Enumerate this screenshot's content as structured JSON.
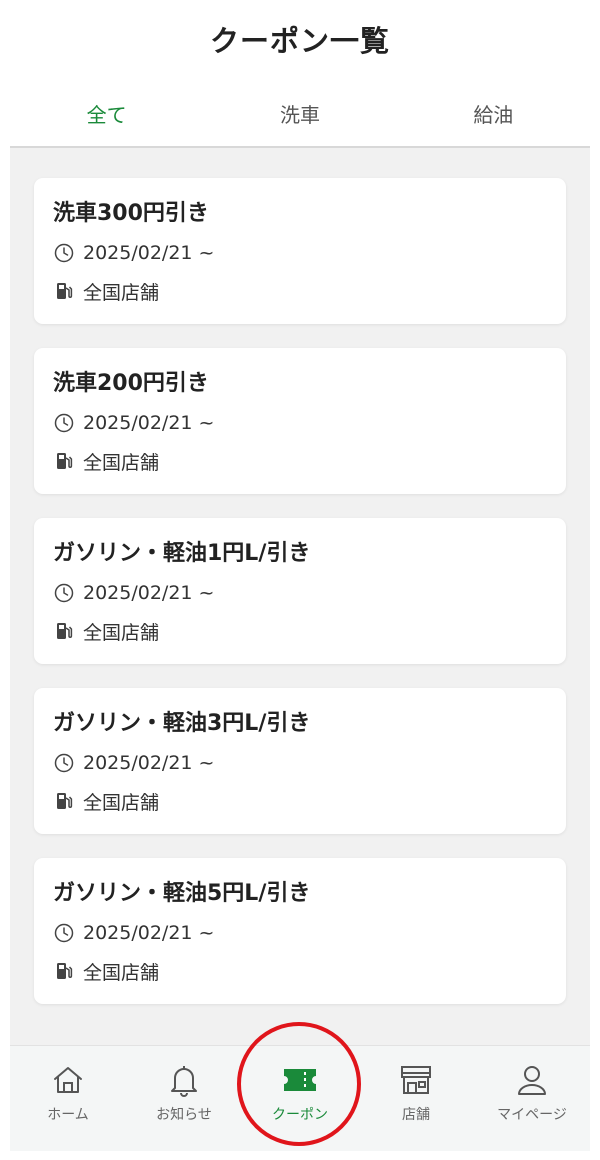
{
  "header": {
    "title": "クーポン一覧"
  },
  "tabs": [
    {
      "label": "全て",
      "active": true
    },
    {
      "label": "洗車",
      "active": false
    },
    {
      "label": "給油",
      "active": false
    }
  ],
  "coupons": [
    {
      "title": "洗車300円引き",
      "date": "2025/02/21 ~",
      "store": "全国店舗"
    },
    {
      "title": "洗車200円引き",
      "date": "2025/02/21 ~",
      "store": "全国店舗"
    },
    {
      "title": "ガソリン・軽油1円L/引き",
      "date": "2025/02/21 ~",
      "store": "全国店舗"
    },
    {
      "title": "ガソリン・軽油3円L/引き",
      "date": "2025/02/21 ~",
      "store": "全国店舗"
    },
    {
      "title": "ガソリン・軽油5円L/引き",
      "date": "2025/02/21 ~",
      "store": "全国店舗"
    }
  ],
  "bottom_nav": [
    {
      "label": "ホーム",
      "icon": "home-icon",
      "active": false
    },
    {
      "label": "お知らせ",
      "icon": "bell-icon",
      "active": false
    },
    {
      "label": "クーポン",
      "icon": "ticket-icon",
      "active": true
    },
    {
      "label": "店舗",
      "icon": "store-icon",
      "active": false
    },
    {
      "label": "マイページ",
      "icon": "user-icon",
      "active": false
    }
  ],
  "colors": {
    "accent": "#1a8a3a",
    "highlight": "#e0151b",
    "background": "#f1f1f1"
  }
}
